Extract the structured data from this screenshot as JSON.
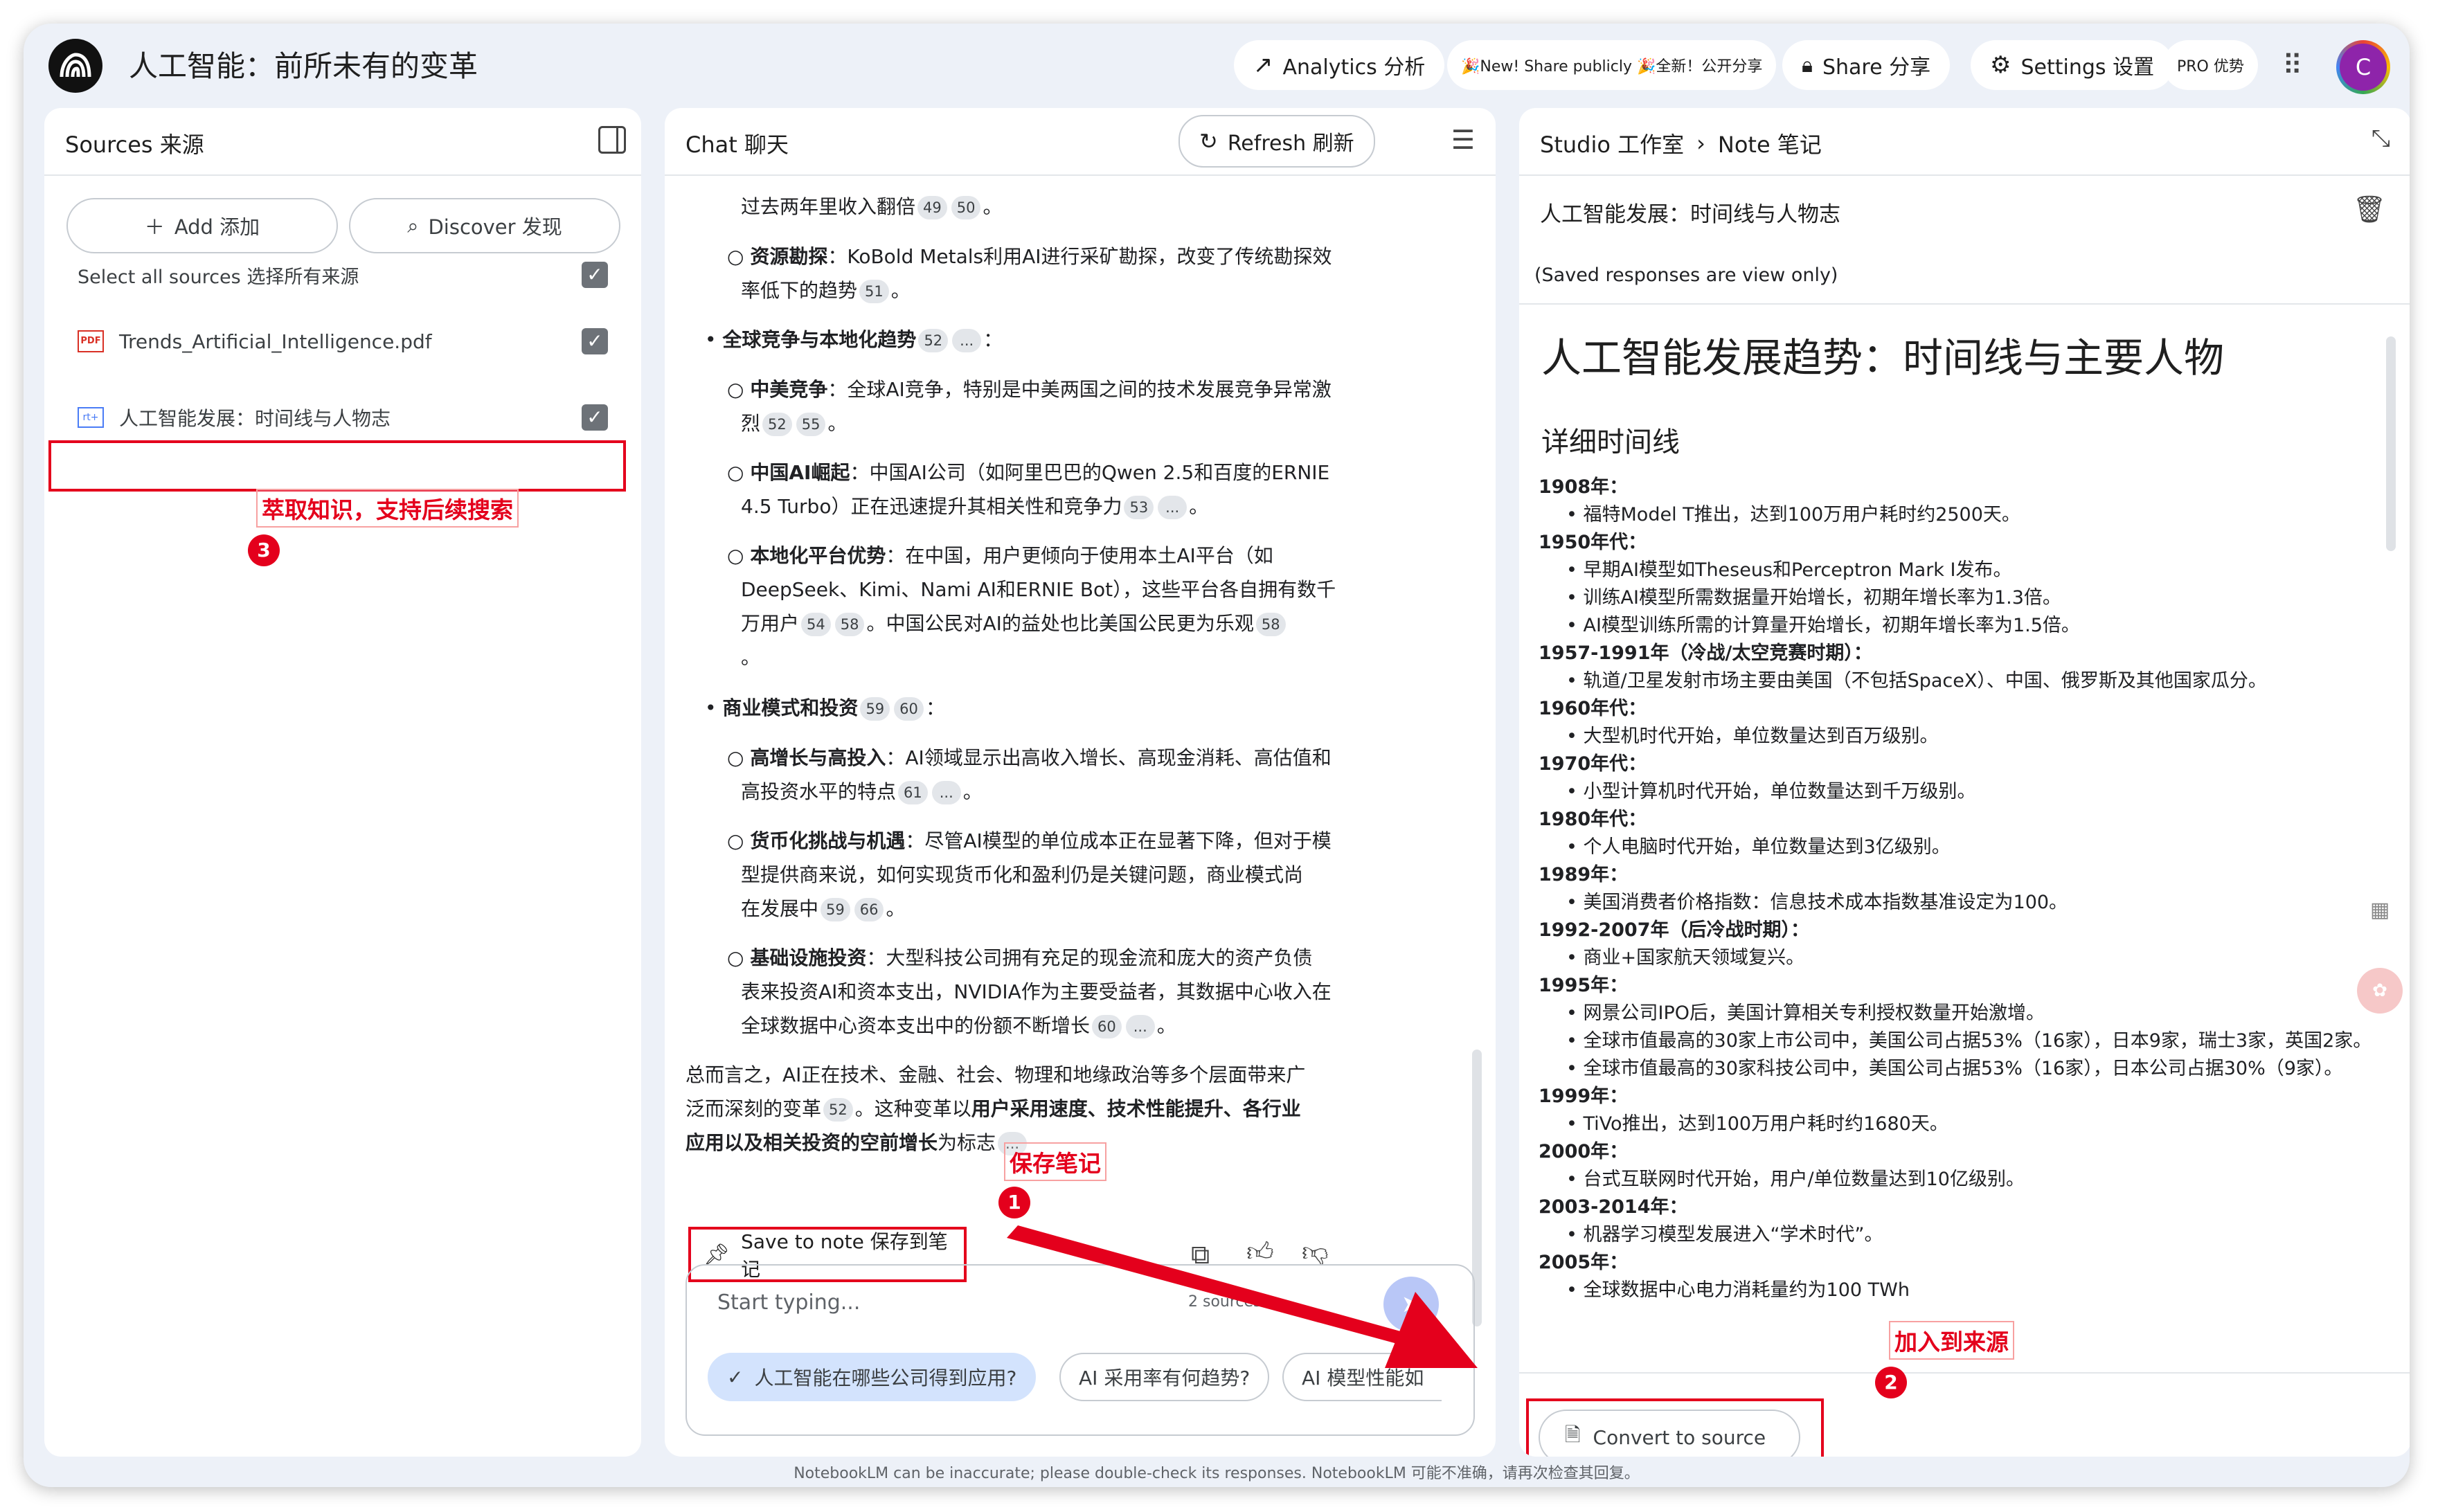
{
  "header": {
    "title": "人工智能：前所未有的变革",
    "analytics": "Analytics 分析",
    "new_share": "🎉New! Share publicly 🎉全新！公开分享",
    "share": "Share 分享",
    "settings": "Settings 设置",
    "pro": "PRO 优势",
    "avatar_letter": "C"
  },
  "sources": {
    "title": "Sources 来源",
    "add": "Add 添加",
    "discover": "Discover 发现",
    "select_all": "Select all sources 选择所有来源",
    "items": [
      {
        "name": "Trends_Artificial_Intelligence.pdf",
        "icon": "pdf-icon",
        "checked": true
      },
      {
        "name": "人工智能发展：时间线与人物志",
        "icon": "note-source-icon",
        "checked": true
      }
    ],
    "annotation": "萃取知识，支持后续搜索",
    "annotation_num": "3"
  },
  "chat": {
    "title": "Chat 聊天",
    "refresh": "Refresh 刷新",
    "lines": {
      "l0": "过去两年里收入翻倍",
      "l1a_bold": "资源勘探",
      "l1a": "：KoBold Metals利用AI进行采矿勘探，改变了传统勘探效",
      "l1b": "率低下的趋势",
      "l2_bold": "全球竞争与本地化趋势",
      "l3a_bold": "中美竞争",
      "l3a": "：全球AI竞争，特别是中美两国之间的技术发展竞争异常激",
      "l3b": "烈",
      "l4a_bold": "中国AI崛起",
      "l4a": "：中国AI公司（如阿里巴巴的Qwen 2.5和百度的ERNIE",
      "l4b": "4.5 Turbo）正在迅速提升其相关性和竞争力",
      "l5a_bold": "本地化平台优势",
      "l5a": "：在中国，用户更倾向于使用本土AI平台（如",
      "l5b": "DeepSeek、Kimi、Nami AI和ERNIE Bot），这些平台各自拥有数千",
      "l5c": "万用户",
      "l5c2": "。中国公民对AI的益处也比美国公民更为乐观",
      "l5d": "。",
      "l6_bold": "商业模式和投资",
      "l7a_bold": "高增长与高投入",
      "l7a": "：AI领域显示出高收入增长、高现金消耗、高估值和",
      "l7b": "高投资水平的特点",
      "l8a_bold": "货币化挑战与机遇",
      "l8a": "：尽管AI模型的单位成本正在显著下降，但对于模",
      "l8b": "型提供商来说，如何实现货币化和盈利仍是关键问题，商业模式尚",
      "l8c": "在发展中",
      "l9a_bold": "基础设施投资",
      "l9a": "：大型科技公司拥有充足的现金流和庞大的资产负债",
      "l9b": "表来投资AI和资本支出，NVIDIA作为主要受益者，其数据中心收入在",
      "l9c": "全球数据中心资本支出中的份额不断增长",
      "s1": "总而言之，AI正在技术、金融、社会、物理和地缘政治等多个层面带来广",
      "s2": "泛而深刻的变革",
      "s2b": "。这种变革以",
      "s2c_bold": "用户采用速度、技术性能提升、各行业",
      "s3_bold": "应用以及相关投资的空前增长",
      "s3": "为标志"
    },
    "citations": {
      "c49": "49",
      "c50": "50",
      "c51": "51",
      "c52": "52",
      "c53": "53",
      "c54": "54",
      "c55": "55",
      "c58": "58",
      "c59": "59",
      "c60": "60",
      "c61": "61",
      "c66": "66",
      "dots": "..."
    },
    "save_note": "Save to note 保存到笔记",
    "annotation": "保存笔记",
    "annotation_num": "1",
    "placeholder": "Start typing...",
    "source_count": "2 sources",
    "suggestions": [
      "人工智能在哪些公司得到应用?",
      "AI 采用率有何趋势?",
      "AI 模型性能如"
    ]
  },
  "studio": {
    "breadcrumb_root": "Studio 工作室",
    "breadcrumb_leaf": "Note 笔记",
    "note_title": "人工智能发展：时间线与人物志",
    "view_only": "(Saved responses are view only)",
    "heading": "人工智能发展趋势：时间线与主要人物",
    "subheading": "详细时间线",
    "timeline": [
      {
        "year": "1908年：",
        "items": [
          "福特Model T推出，达到100万用户耗时约2500天。"
        ]
      },
      {
        "year": "1950年代：",
        "items": [
          "早期AI模型如Theseus和Perceptron Mark I发布。",
          "训练AI模型所需数据量开始增长，初期年增长率为1.3倍。",
          "AI模型训练所需的计算量开始增长，初期年增长率为1.5倍。"
        ]
      },
      {
        "year": "1957-1991年（冷战/太空竞赛时期）：",
        "items": [
          "轨道/卫星发射市场主要由美国（不包括SpaceX）、中国、俄罗斯及其他国家瓜分。"
        ]
      },
      {
        "year": "1960年代：",
        "items": [
          "大型机时代开始，单位数量达到百万级别。"
        ]
      },
      {
        "year": "1970年代：",
        "items": [
          "小型计算机时代开始，单位数量达到千万级别。"
        ]
      },
      {
        "year": "1980年代：",
        "items": [
          "个人电脑时代开始，单位数量达到3亿级别。"
        ]
      },
      {
        "year": "1989年：",
        "items": [
          "美国消费者价格指数：信息技术成本指数基准设定为100。"
        ]
      },
      {
        "year": "1992-2007年（后冷战时期）：",
        "items": [
          "商业+国家航天领域复兴。"
        ]
      },
      {
        "year": "1995年：",
        "items": [
          "网景公司IPO后，美国计算相关专利授权数量开始激增。",
          "全球市值最高的30家上市公司中，美国公司占据53%（16家），日本9家，瑞士3家，英国2家。",
          "全球市值最高的30家科技公司中，美国公司占据53%（16家），日本公司占据30%（9家）。"
        ]
      },
      {
        "year": "1999年：",
        "items": [
          "TiVo推出，达到100万用户耗时约1680天。"
        ]
      },
      {
        "year": "2000年：",
        "items": [
          "台式互联网时代开始，用户/单位数量达到10亿级别。"
        ]
      },
      {
        "year": "2003-2014年：",
        "items": [
          "机器学习模型发展进入“学术时代”。"
        ]
      },
      {
        "year": "2005年：",
        "items": [
          "全球数据中心电力消耗量约为100 TWh"
        ]
      }
    ],
    "convert": "Convert to source",
    "annotation": "加入到来源",
    "annotation_num": "2"
  },
  "footer": "NotebookLM can be inaccurate; please double-check its responses. NotebookLM 可能不准确，请再次检查其回复。",
  "colors": {
    "annotation_red": "#e4001c",
    "window_bg": "#edf1f8",
    "chip_active": "#d3e3fd"
  }
}
